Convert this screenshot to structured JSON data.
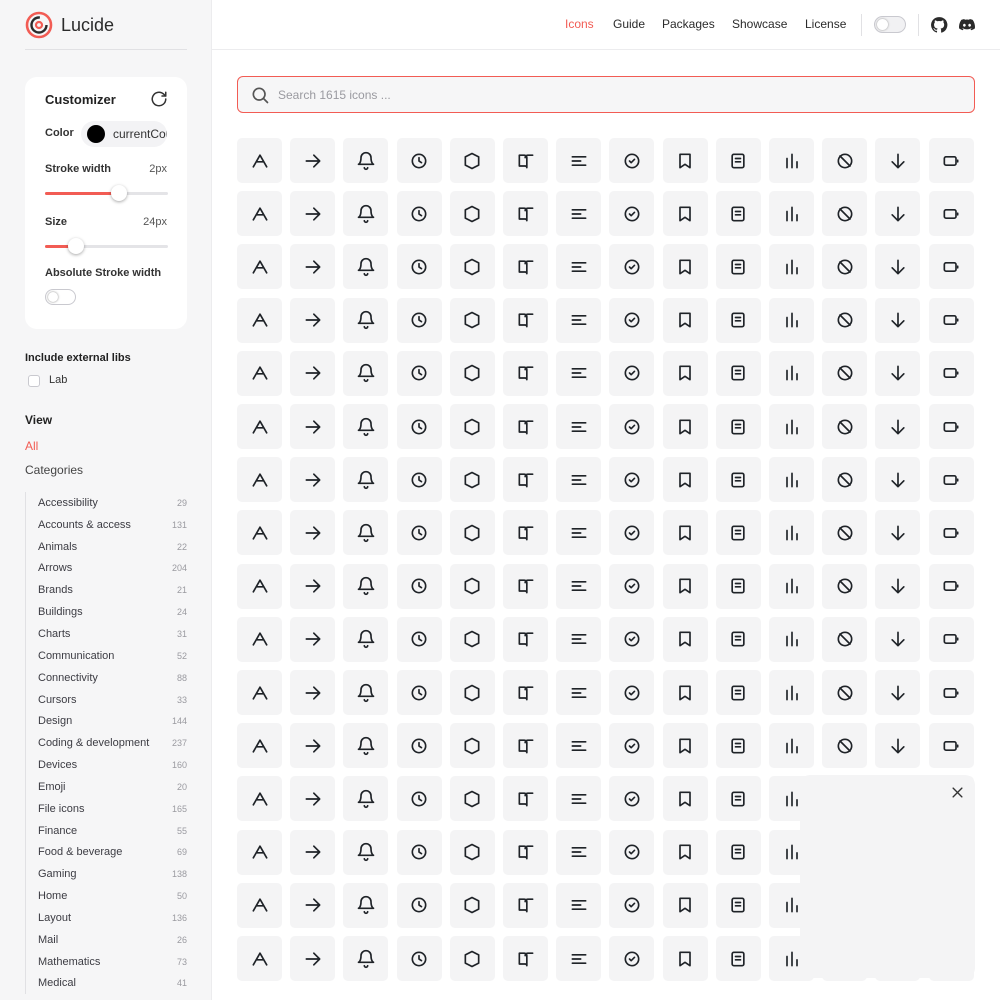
{
  "brand": {
    "name": "Lucide"
  },
  "nav": {
    "links": [
      "Icons",
      "Guide",
      "Packages",
      "Showcase",
      "License"
    ],
    "active": "Icons"
  },
  "customizer": {
    "title": "Customizer",
    "color_label": "Color",
    "color_value": "currentColor",
    "stroke_label": "Stroke width",
    "stroke_value": "2px",
    "stroke_level": 0.6,
    "size_label": "Size",
    "size_value": "24px",
    "size_level": 0.25,
    "absolute_label": "Absolute Stroke width"
  },
  "external": {
    "title": "Include external libs",
    "lib_label": "Lab"
  },
  "view": {
    "title": "View",
    "all_label": "All",
    "categories_title": "Categories"
  },
  "categories": [
    {
      "name": "Accessibility",
      "count": "29"
    },
    {
      "name": "Accounts & access",
      "count": "131"
    },
    {
      "name": "Animals",
      "count": "22"
    },
    {
      "name": "Arrows",
      "count": "204"
    },
    {
      "name": "Brands",
      "count": "21"
    },
    {
      "name": "Buildings",
      "count": "24"
    },
    {
      "name": "Charts",
      "count": "31"
    },
    {
      "name": "Communication",
      "count": "52"
    },
    {
      "name": "Connectivity",
      "count": "88"
    },
    {
      "name": "Cursors",
      "count": "33"
    },
    {
      "name": "Design",
      "count": "144"
    },
    {
      "name": "Coding & development",
      "count": "237"
    },
    {
      "name": "Devices",
      "count": "160"
    },
    {
      "name": "Emoji",
      "count": "20"
    },
    {
      "name": "File icons",
      "count": "165"
    },
    {
      "name": "Finance",
      "count": "55"
    },
    {
      "name": "Food & beverage",
      "count": "69"
    },
    {
      "name": "Gaming",
      "count": "138"
    },
    {
      "name": "Home",
      "count": "50"
    },
    {
      "name": "Layout",
      "count": "136"
    },
    {
      "name": "Mail",
      "count": "26"
    },
    {
      "name": "Mathematics",
      "count": "73"
    },
    {
      "name": "Medical",
      "count": "41"
    }
  ],
  "search": {
    "placeholder": "Search 1615 icons ..."
  },
  "colors": {
    "accent": "#f25c54",
    "tile_bg": "#f4f4f5"
  },
  "icons": [
    [
      "a-arrow-down",
      "a-arrow-up",
      "a-large-small",
      "accessibility",
      "activity",
      "air-vent",
      "airplay",
      "alarm-clock",
      "alarm-clock-check",
      "alarm-clock-minus",
      "alarm-clock-off",
      "alarm-clock-plus",
      "alarm-smoke",
      "album"
    ],
    [
      "align-center",
      "align-center-horizontal",
      "align-center-vertical",
      "align-end-horizontal",
      "align-end-vertical",
      "align-horizontal-distribute-center",
      "align-horizontal-distribute-end",
      "align-horizontal-distribute-start",
      "align-horizontal-justify-center",
      "align-horizontal-justify-end",
      "align-horizontal-justify-start",
      "align-horizontal-space-around",
      "align-horizontal-space-between",
      "align-justify"
    ],
    [
      "align-left",
      "align-right",
      "align-start-horizontal",
      "align-start-vertical",
      "align-vertical-distribute-center",
      "align-vertical-distribute-end",
      "align-vertical-distribute-start",
      "align-vertical-justify-center",
      "align-vertical-justify-end",
      "align-vertical-justify-start",
      "align-vertical-space-around",
      "align-vertical-space-between",
      "ambulance",
      "ampersand"
    ],
    [
      "ampersands",
      "amphora",
      "anchor",
      "angry",
      "annoyed",
      "antenna",
      "anvil",
      "aperture",
      "app-window",
      "app-window-mac",
      "apple",
      "archive",
      "archive-restore",
      "archive-x"
    ],
    [
      "armchair",
      "arrow-big-down",
      "arrow-big-down-dash",
      "arrow-big-left",
      "arrow-big-left-dash",
      "arrow-big-right",
      "arrow-big-right-dash",
      "arrow-big-up",
      "arrow-big-up-dash",
      "arrow-down",
      "arrow-down-0-1",
      "arrow-down-1-0",
      "arrow-down-a-z",
      "arrow-down-to-line"
    ],
    [
      "arrow-down-left",
      "arrow-down-narrow-wide",
      "arrow-down-right",
      "arrow-down-from-line",
      "arrow-down-to-dot",
      "arrow-down-up",
      "arrow-down-wide-narrow",
      "arrow-down-z-a",
      "arrow-left",
      "arrow-left-from-line",
      "arrow-left-right",
      "arrow-left-to-line",
      "arrow-right",
      "arrow-right-from-line"
    ],
    [
      "arrow-right-left",
      "arrow-right-to-line",
      "arrow-up",
      "arrow-up-0-1",
      "arrow-up-1-0",
      "arrow-up-a-z",
      "arrow-up-down",
      "arrow-up-from-dot",
      "arrow-up-from-line",
      "arrow-up-left",
      "arrow-up-narrow-wide",
      "arrow-up-right",
      "arrow-up-to-line",
      "arrow-up-wide-narrow"
    ],
    [
      "arrow-up-z-a",
      "arrows-up-from-line",
      "asterisk",
      "at-sign",
      "atom",
      "audio-lines",
      "audio-waveform",
      "award",
      "axe",
      "axis-3d",
      "baby",
      "backpack",
      "badge",
      "badge-alert"
    ],
    [
      "badge-cent",
      "badge-check",
      "badge-dollar-sign",
      "badge-euro",
      "badge-indian-rupee",
      "badge-info",
      "badge-japanese-yen",
      "badge-minus",
      "badge-percent",
      "badge-plus",
      "badge-pound-sterling",
      "badge-help",
      "badge-russian-ruble",
      "badge-swiss-franc"
    ],
    [
      "badge-turkish-lira",
      "badge-x",
      "baggage-claim",
      "ban",
      "banana",
      "banknote",
      "banknote-small",
      "banknote-arrow-down",
      "banknote-arrow-up",
      "banknote-x",
      "barcode",
      "baseline",
      "bath",
      "bath-tub"
    ],
    [
      "battery",
      "battery-charging",
      "battery-full",
      "battery-low",
      "battery-medium",
      "battery-plus",
      "battery-warning",
      "beaker",
      "bean",
      "bean-off",
      "bed",
      "bed-double",
      "bed-single",
      "beef"
    ],
    [
      "beer",
      "beer-off",
      "bell",
      "bell-dot",
      "bell-electric",
      "bell-minus",
      "bell-off",
      "bell-plus",
      "bell-ring",
      "between-horizontal-end",
      "between-horizontal-start",
      "between-vertical-end",
      "between-vertical-start",
      "biceps-flexed"
    ],
    [
      "bike",
      "binary",
      "binoculars",
      "biohazard",
      "bird",
      "bitcoin",
      "blend",
      "blinds",
      "blocks",
      "bluetooth",
      "bluetooth-connected",
      "bluetooth-off",
      "bluetooth-searching",
      "bold"
    ],
    [
      "bolt",
      "bomb",
      "bone",
      "book",
      "book-a",
      "book-alert",
      "book-audio",
      "book-check",
      "book-copy",
      "book-dashed",
      "book-down",
      "book-headphones",
      "book-heart",
      "book-image"
    ],
    [
      "book-key",
      "book-lock",
      "book-marked",
      "book-minus",
      "book-open",
      "book-open-check",
      "book-open-text",
      "book-plus",
      "book-text",
      "book-type",
      "book-up",
      "book-up-2",
      "book-user",
      "book-x"
    ],
    [
      "bookmark",
      "bookmark-check",
      "bookmark-minus",
      "bookmark-plus",
      "bookmark-x",
      "boom-box",
      "bot",
      "bot-message-square",
      "bot-off",
      "bottle-wine",
      "bow-arrow",
      "box",
      "boxes",
      "braces"
    ]
  ]
}
